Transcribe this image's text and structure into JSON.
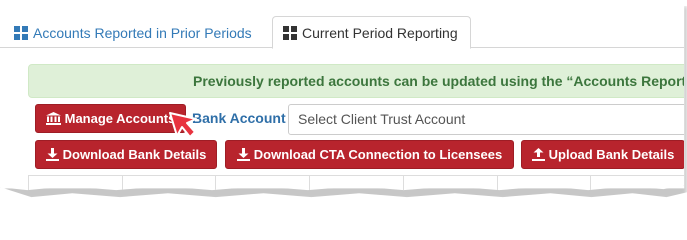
{
  "tabs": {
    "prior": {
      "label": "Accounts Reported in Prior Periods",
      "icon": "grid-icon"
    },
    "current": {
      "label": "Current Period Reporting",
      "icon": "grid-icon"
    }
  },
  "alert": {
    "text": "Previously reported accounts can be updated using the “Accounts Reported in"
  },
  "toolbar": {
    "manage_label": "Manage Accounts",
    "manage_icon": "bank-icon",
    "bank_account_label": "Bank Account",
    "bank_select_value": "Select Client Trust Account"
  },
  "actions": {
    "download_bank_label": "Download Bank Details",
    "download_cta_label": "Download CTA Connection to Licensees",
    "upload_bank_label": "Upload Bank Details",
    "download_icon": "download-icon",
    "upload_icon": "upload-icon"
  },
  "colors": {
    "button": "#b8242d",
    "link": "#337ab7",
    "alert_bg": "#dff0d8",
    "alert_text": "#3c763d",
    "cursor": "#e8333f"
  }
}
